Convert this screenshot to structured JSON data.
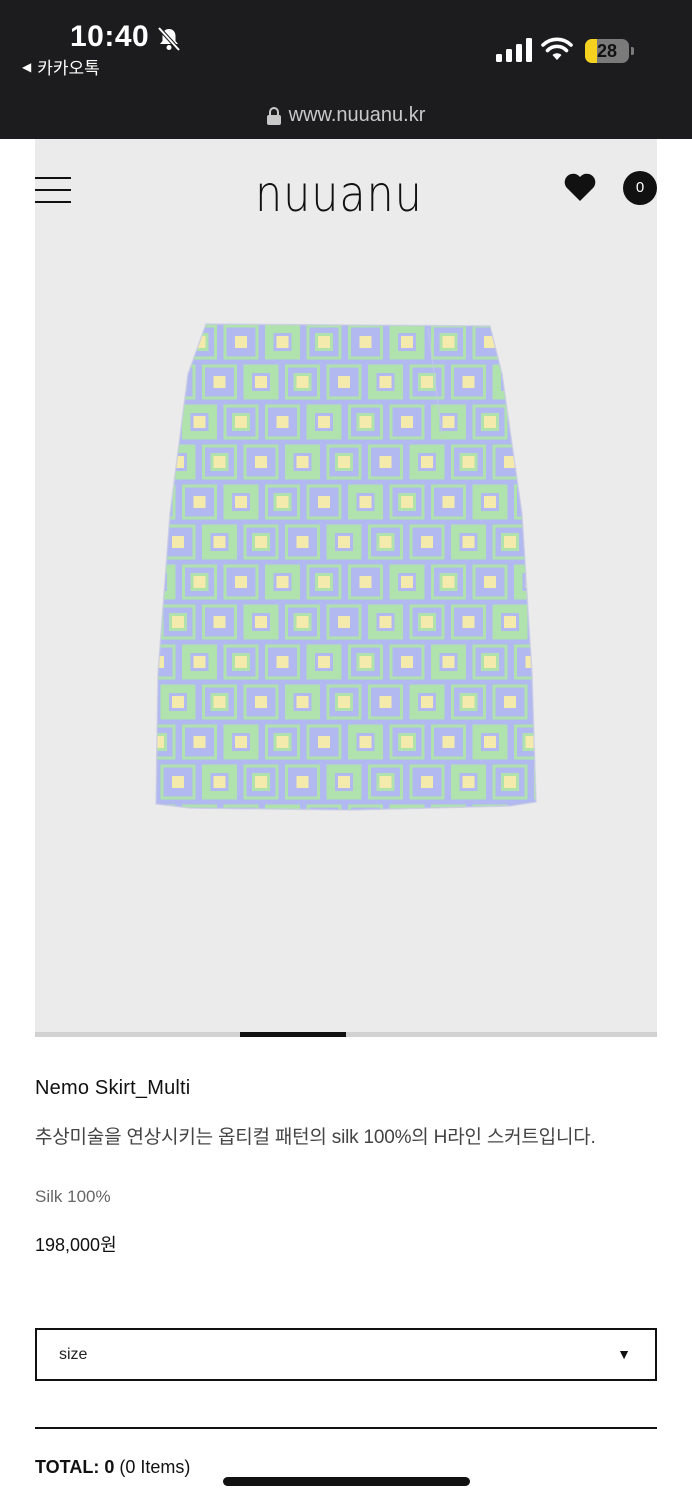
{
  "status_bar": {
    "time": "10:40",
    "back_app": "카카오톡",
    "battery_level": "28",
    "battery_fraction": 0.28,
    "url": "www.nuuanu.kr"
  },
  "header": {
    "logo": "nuuanu",
    "cart_count": "0"
  },
  "gallery": {
    "current_slide_fraction_start": 0.33,
    "current_slide_fraction_end": 0.5,
    "pattern_colors": {
      "base": "#a8b0ef",
      "green": "#a4dfa2",
      "yellow": "#f3e8a0"
    }
  },
  "product": {
    "name": "Nemo Skirt_Multi",
    "description": "추상미술을 연상시키는 옵티컬 패턴의 silk 100%의 H라인 스커트입니다.",
    "material": "Silk 100%",
    "price": "198,000원"
  },
  "options": {
    "size_label": "size"
  },
  "total": {
    "label": "TOTAL:",
    "amount": "0",
    "items": "(0 Items)"
  }
}
